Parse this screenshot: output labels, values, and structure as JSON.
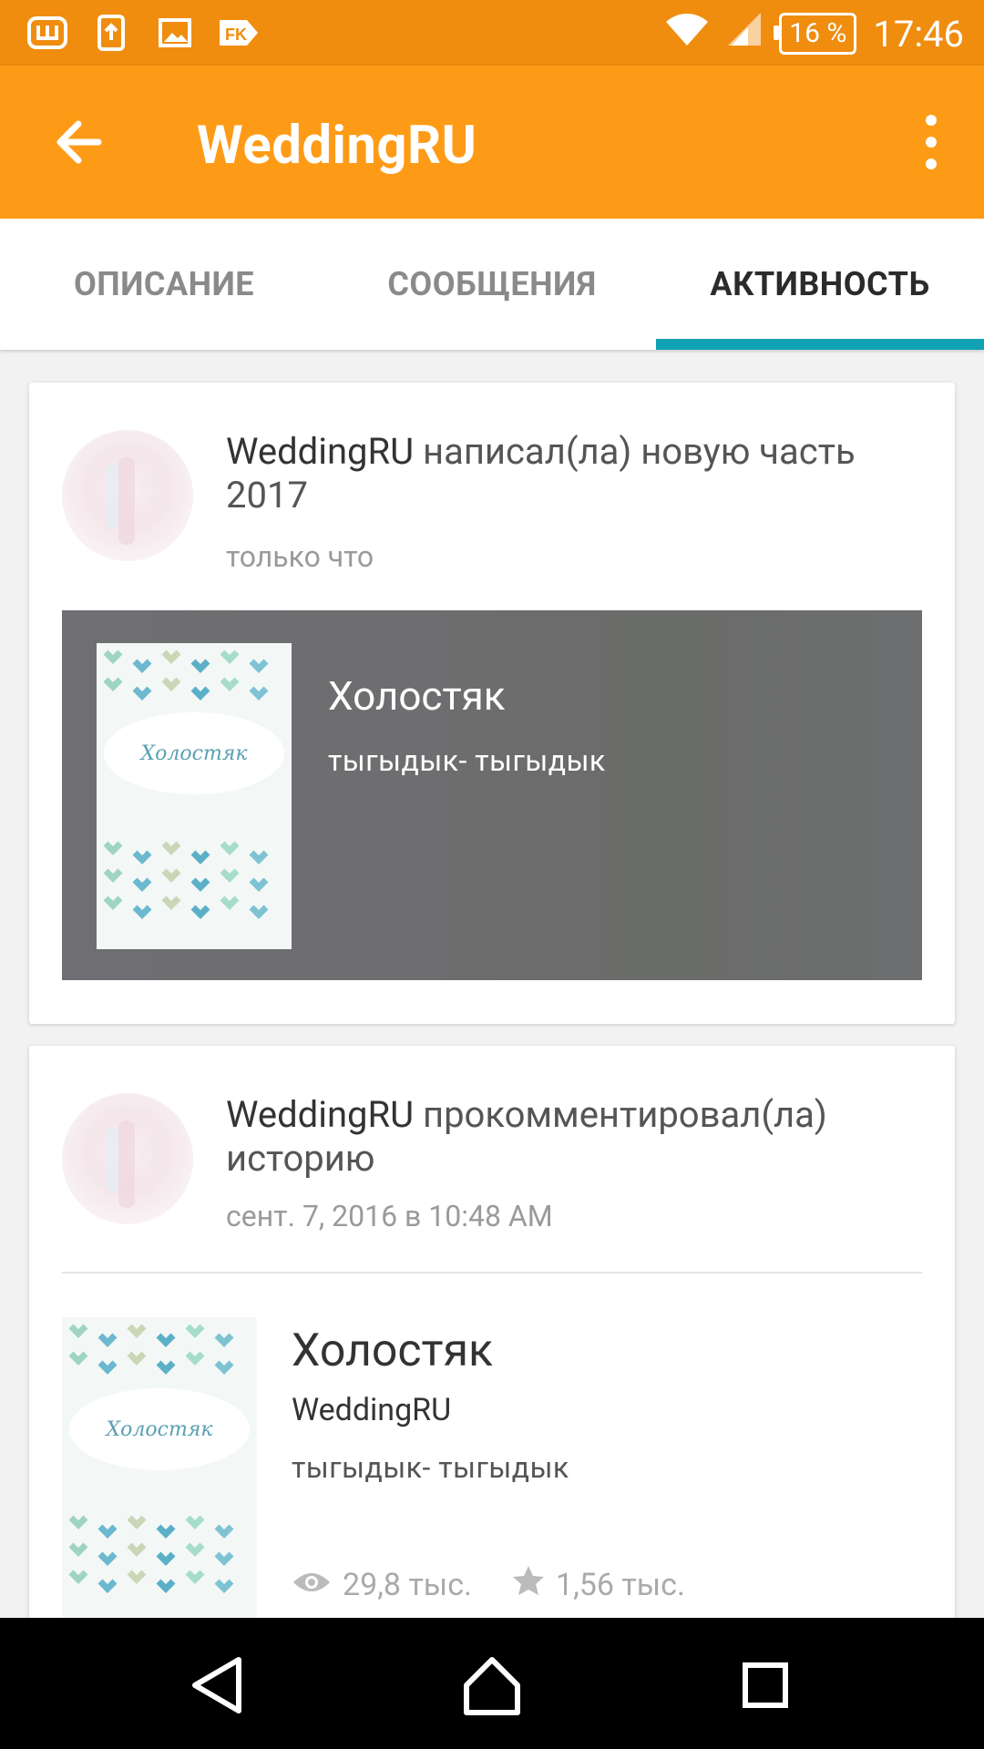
{
  "status_bar": {
    "battery": "16 %",
    "time": "17:46",
    "left_icons": [
      "shazam-like-icon",
      "upload-icon",
      "image-icon",
      "fk-icon"
    ]
  },
  "app_bar": {
    "title": "WeddingRU"
  },
  "tabs": [
    {
      "label": "ОПИСАНИЕ",
      "active": false
    },
    {
      "label": "СООБЩЕНИЯ",
      "active": false
    },
    {
      "label": "АКТИВНОСТЬ",
      "active": true
    }
  ],
  "feed": [
    {
      "user": "WeddingRU",
      "action": "написал(ла) новую часть 2017",
      "time": "только что",
      "story": {
        "title": "Холостяк",
        "description": "тыгыдык- тыгыдык",
        "cover_text": "Холостяк"
      }
    },
    {
      "user": "WeddingRU",
      "action": "прокомментировал(ла) историю",
      "time": "сент. 7, 2016 в 10:48 AM",
      "story": {
        "title": "Холостяк",
        "author": "WeddingRU",
        "description": "тыгыдык- тыгыдык",
        "cover_text": "Холостяк",
        "views": "29,8 тыс.",
        "votes": "1,56 тыс."
      }
    }
  ],
  "colors": {
    "status_bar": "#F08D0E",
    "app_bar": "#FD9B17",
    "tab_indicator": "#11A2B3"
  }
}
